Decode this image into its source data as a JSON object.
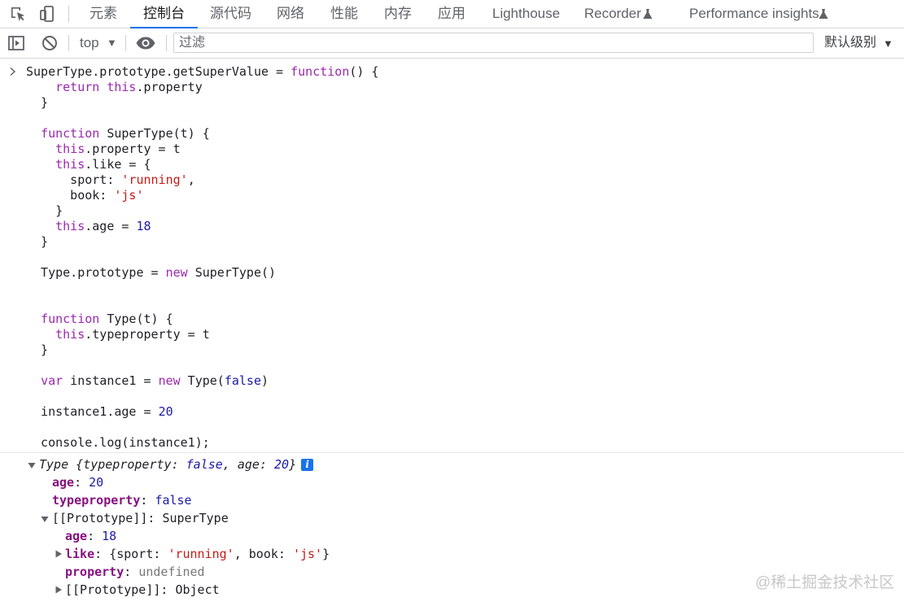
{
  "tabs": [
    {
      "label": "元素"
    },
    {
      "label": "控制台"
    },
    {
      "label": "源代码"
    },
    {
      "label": "网络"
    },
    {
      "label": "性能"
    },
    {
      "label": "内存"
    },
    {
      "label": "应用"
    },
    {
      "label": "Lighthouse"
    },
    {
      "label": "Recorder"
    },
    {
      "label": "Performance insights"
    }
  ],
  "active_tab": "控制台",
  "toolbar": {
    "context": "top",
    "filter_placeholder": "过滤",
    "log_level": "默认级别"
  },
  "input_code": "SuperType.prototype.getSuperValue = function() {\n    return this.property\n  }\n\n  function SuperType(t) {\n    this.property = t\n    this.like = {\n      sport: 'running',\n      book: 'js'\n    }\n    this.age = 18\n  }\n\n  Type.prototype = new SuperType()\n\n\n  function Type(t) {\n    this.typeproperty = t\n  }\n\n  var instance1 = new Type(false)\n\n  instance1.age = 20\n\n  console.log(instance1);",
  "output": {
    "summary": {
      "type": "Type",
      "open": "{",
      "k1": "typeproperty",
      "v1": "false",
      "k2": "age",
      "v2": "20",
      "close": "}"
    },
    "props": [
      {
        "key": "age",
        "value": "20"
      },
      {
        "key": "typeproperty",
        "value": "false"
      }
    ],
    "proto": {
      "key": "[[Prototype]]",
      "value": "SuperType",
      "props": [
        {
          "key": "age",
          "value": "18"
        },
        {
          "key": "like",
          "preview_open": "{sport: ",
          "sport": "'running'",
          "mid": ", book: ",
          "book": "'js'",
          "preview_close": "}"
        },
        {
          "key": "property",
          "value": "undefined"
        },
        {
          "key": "[[Prototype]]",
          "value": "Object"
        }
      ]
    }
  },
  "watermark": "@稀土掘金技术社区",
  "colors": {
    "accent": "#1a73e8",
    "keyword": "#9c27b0",
    "string": "#c41a16",
    "number": "#1c1aa5",
    "property_key": "#881280"
  }
}
